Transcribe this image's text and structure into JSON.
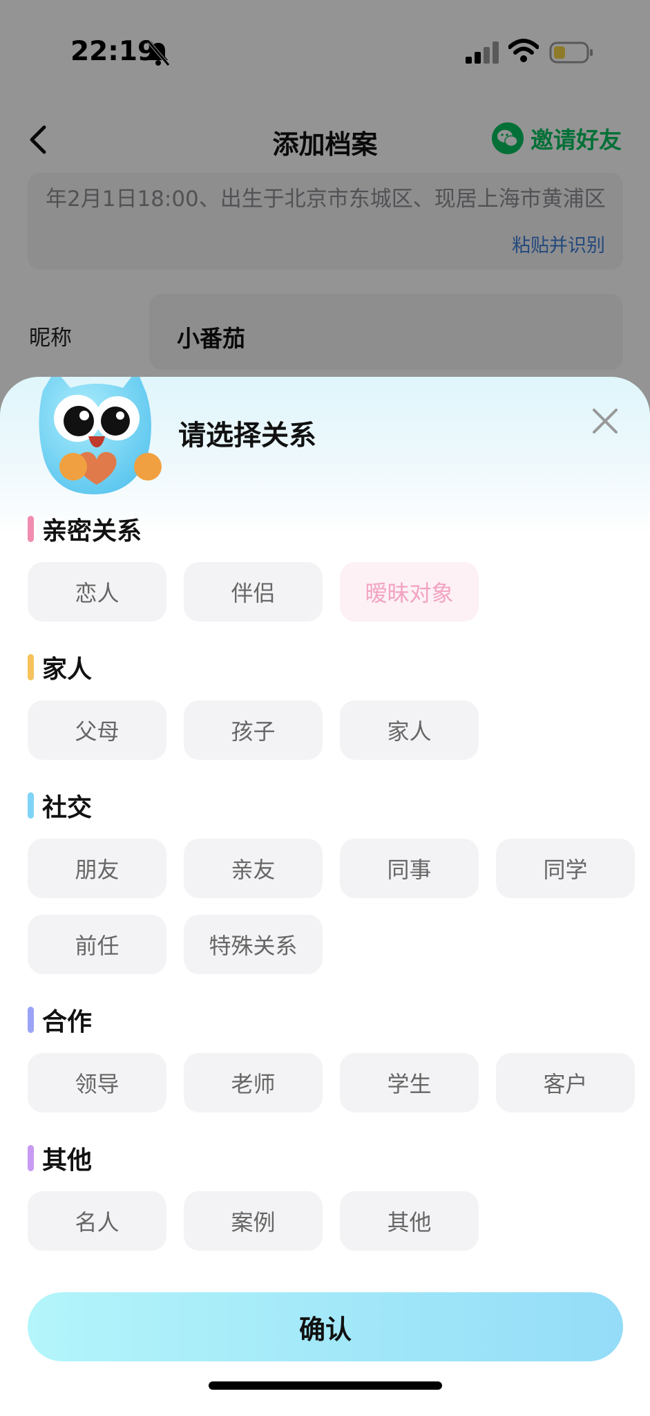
{
  "status_bar": {
    "time": "22:19"
  },
  "nav": {
    "title": "添加档案",
    "invite_label": "邀请好友"
  },
  "paste": {
    "text": "年2月1日18:00、出生于北京市东城区、现居上海市黄浦区",
    "action": "粘贴并识别"
  },
  "nickname": {
    "label": "昵称",
    "value": "小番茄"
  },
  "sheet": {
    "title": "请选择关系",
    "sections": [
      {
        "title": "亲密关系",
        "color": "#f08db1",
        "items": [
          "恋人",
          "伴侣",
          "暧昧对象"
        ],
        "selected": "暧昧对象"
      },
      {
        "title": "家人",
        "color": "#f6c25c",
        "items": [
          "父母",
          "孩子",
          "家人"
        ]
      },
      {
        "title": "社交",
        "color": "#7fd3f7",
        "items": [
          "朋友",
          "亲友",
          "同事",
          "同学",
          "前任",
          "特殊关系"
        ]
      },
      {
        "title": "合作",
        "color": "#9aa3f6",
        "items": [
          "领导",
          "老师",
          "学生",
          "客户"
        ]
      },
      {
        "title": "其他",
        "color": "#c79bf2",
        "items": [
          "名人",
          "案例",
          "其他"
        ]
      }
    ],
    "confirm_label": "确认"
  }
}
